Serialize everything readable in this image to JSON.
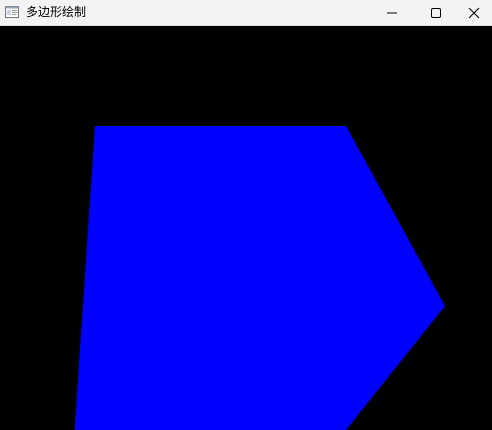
{
  "window": {
    "title": "多边形绘制"
  },
  "icons": {
    "app": "app-window-icon",
    "minimize": "minimize-icon",
    "maximize": "maximize-icon",
    "close": "close-icon"
  },
  "colors": {
    "polygon_fill": "#0000ff",
    "canvas_background": "#000000",
    "titlebar_background": "#f3f3f3"
  }
}
